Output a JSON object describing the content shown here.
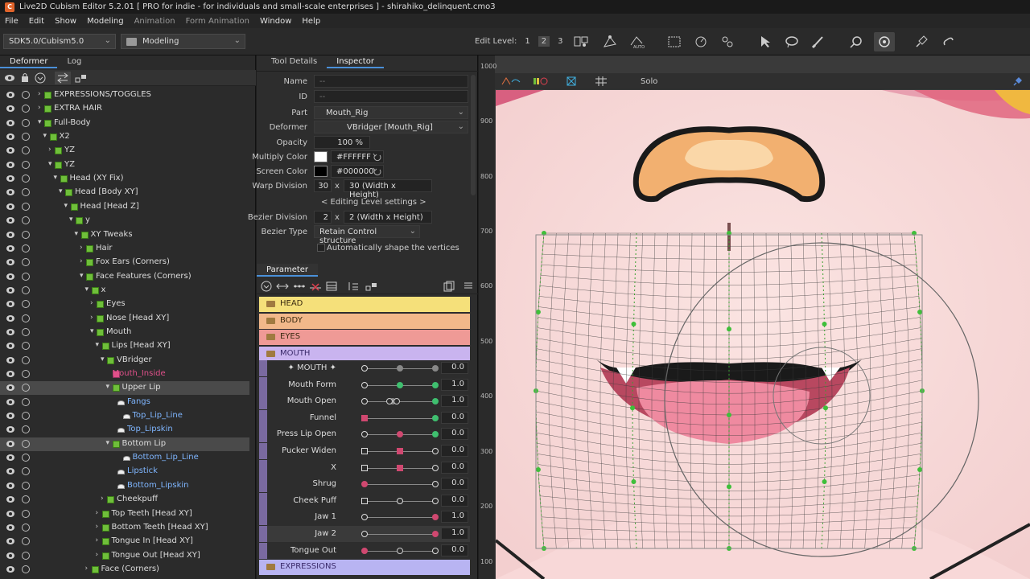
{
  "window": {
    "title": "Live2D Cubism Editor 5.2.01    [ PRO for indie - for individuals and small-scale enterprises ]  - shirahiko_delinquent.cmo3"
  },
  "menu": [
    "File",
    "Edit",
    "Show",
    "Modeling",
    "Animation",
    "Form Animation",
    "Window",
    "Help"
  ],
  "toolbar": {
    "sdk": "SDK5.0/Cubism5.0",
    "mode": "Modeling",
    "edit_level_label": "Edit Level:",
    "levels": [
      "1",
      "2",
      "3"
    ]
  },
  "left_tabs": [
    "Deformer",
    "Log"
  ],
  "tree": [
    {
      "label": "EXPRESSIONS/TOGGLES",
      "indent": 0,
      "type": "folder"
    },
    {
      "label": "EXTRA HAIR",
      "indent": 0,
      "type": "folder"
    },
    {
      "label": "Full-Body",
      "indent": 0,
      "type": "deformer",
      "open": true
    },
    {
      "label": "X2",
      "indent": 1,
      "type": "deformer",
      "open": true
    },
    {
      "label": "YZ",
      "indent": 2,
      "type": "deformer"
    },
    {
      "label": "YZ",
      "indent": 2,
      "type": "deformer",
      "open": true
    },
    {
      "label": "Head (XY Fix)",
      "indent": 3,
      "type": "deformer",
      "open": true
    },
    {
      "label": "Head [Body XY]",
      "indent": 4,
      "type": "deformer",
      "open": true
    },
    {
      "label": "Head [Head Z]",
      "indent": 5,
      "type": "deformer",
      "open": true
    },
    {
      "label": "y",
      "indent": 6,
      "type": "deformer",
      "open": true
    },
    {
      "label": "XY Tweaks",
      "indent": 7,
      "type": "deformer",
      "open": true
    },
    {
      "label": "Hair",
      "indent": 8,
      "type": "deformer"
    },
    {
      "label": "Fox Ears (Corners)",
      "indent": 8,
      "type": "deformer"
    },
    {
      "label": "Face Features (Corners)",
      "indent": 8,
      "type": "deformer",
      "open": true
    },
    {
      "label": "x",
      "indent": 9,
      "type": "deformer",
      "open": true
    },
    {
      "label": "Eyes",
      "indent": 10,
      "type": "deformer"
    },
    {
      "label": "Nose [Head XY]",
      "indent": 10,
      "type": "deformer"
    },
    {
      "label": "Mouth",
      "indent": 10,
      "type": "deformer",
      "open": true
    },
    {
      "label": "Lips [Head XY]",
      "indent": 11,
      "type": "deformer",
      "open": true
    },
    {
      "label": "VBridger",
      "indent": 12,
      "type": "deformer",
      "open": true
    },
    {
      "label": "Mouth_Inside",
      "indent": 13,
      "type": "clip"
    },
    {
      "label": "Upper Lip",
      "indent": 13,
      "type": "deformer",
      "open": true,
      "selected": true
    },
    {
      "label": "Fangs",
      "indent": 14,
      "type": "art"
    },
    {
      "label": "Top_Lip_Line",
      "indent": 15,
      "type": "art"
    },
    {
      "label": "Top_Lipskin",
      "indent": 14,
      "type": "art"
    },
    {
      "label": "Bottom Lip",
      "indent": 13,
      "type": "deformer",
      "open": true,
      "selected": true
    },
    {
      "label": "Bottom_Lip_Line",
      "indent": 15,
      "type": "art"
    },
    {
      "label": "Lipstick",
      "indent": 14,
      "type": "art"
    },
    {
      "label": "Bottom_Lipskin",
      "indent": 14,
      "type": "art"
    },
    {
      "label": "Cheekpuff",
      "indent": 12,
      "type": "deformer"
    },
    {
      "label": "Top Teeth [Head XY]",
      "indent": 11,
      "type": "deformer"
    },
    {
      "label": "Bottom Teeth [Head XY]",
      "indent": 11,
      "type": "deformer"
    },
    {
      "label": "Tongue In [Head XY]",
      "indent": 11,
      "type": "deformer"
    },
    {
      "label": "Tongue Out [Head XY]",
      "indent": 11,
      "type": "deformer"
    },
    {
      "label": "Face (Corners)",
      "indent": 9,
      "type": "deformer"
    }
  ],
  "inspector": {
    "tabs": [
      "Tool Details",
      "Inspector"
    ],
    "name_label": "Name",
    "name_value": "--",
    "id_label": "ID",
    "id_value": "--",
    "part_label": "Part",
    "part_value": "Mouth_Rig",
    "deformer_label": "Deformer",
    "deformer_value": "VBridger  [Mouth_Rig]",
    "opacity_label": "Opacity",
    "opacity_value": "100 %",
    "multiply_label": "Multiply Color",
    "multiply_value": "#FFFFFF",
    "multiply_color": "#ffffff",
    "screen_label": "Screen Color",
    "screen_value": "#000000",
    "screen_color": "#000000",
    "warp_label": "Warp Division",
    "warp_w": "30",
    "warp_x": "x",
    "warp_h": "30 (Width x Height)",
    "editing_level": "< Editing Level settings >",
    "bezier_div_label": "Bezier Division",
    "bezier_w": "2",
    "bezier_x": "x",
    "bezier_h": "2 (Width x Height)",
    "bezier_type_label": "Bezier Type",
    "bezier_type_value": "Retain Control structure",
    "auto_shape": "Automatically shape the vertices"
  },
  "parameter": {
    "tab": "Parameter",
    "groups": [
      {
        "name": "HEAD",
        "color": "#f5e07a"
      },
      {
        "name": "BODY",
        "color": "#f2b88a"
      },
      {
        "name": "EYES",
        "color": "#ef9a96"
      },
      {
        "name": "MOUTH",
        "color": "#c9b4ef"
      }
    ],
    "params": [
      {
        "name": "✦ MOUTH ✦",
        "value": "0.0",
        "knob": 0.5,
        "knob_color": "#888",
        "end_color": "#888"
      },
      {
        "name": "Mouth Form",
        "value": "1.0",
        "knob": 0.5,
        "knob_color": "#3fbf6f",
        "end_color": "#3fbf6f",
        "keys": [
          0,
          0.5,
          1
        ]
      },
      {
        "name": "Mouth Open",
        "value": "1.0",
        "knob": 0.4,
        "knob_color": "#888",
        "end_color": "#3fbf6f",
        "keys": [
          0,
          0.35,
          0.45,
          1
        ]
      },
      {
        "name": "Funnel",
        "value": "0.0",
        "knob": 0,
        "knob_color": "#d04870",
        "end_color": "#3fbf6f",
        "square": true
      },
      {
        "name": "Press Lip Open",
        "value": "0.0",
        "knob": 0.5,
        "knob_color": "#d04870",
        "end_color": "#3fbf6f",
        "keys": [
          0,
          1
        ]
      },
      {
        "name": "Pucker Widen",
        "value": "0.0",
        "knob": 0.5,
        "knob_color": "#d04870",
        "end_color": "#ddd",
        "square": true
      },
      {
        "name": "X",
        "value": "0.0",
        "knob": 0.5,
        "knob_color": "#d04870",
        "end_color": "#ddd",
        "square": true
      },
      {
        "name": "Shrug",
        "value": "0.0",
        "knob": 0,
        "knob_color": "#d04870",
        "end_color": "#ddd"
      },
      {
        "name": "Cheek Puff",
        "value": "0.0",
        "knob": 0.5,
        "knob_color": "#ddd",
        "end_color": "#ddd",
        "square": true,
        "start_color": "#d04870"
      },
      {
        "name": "Jaw 1",
        "value": "1.0",
        "knob": 1,
        "knob_color": "#d04870",
        "end_color": "#d04870"
      },
      {
        "name": "Jaw 2",
        "value": "1.0",
        "knob": 1,
        "knob_color": "#d04870",
        "end_color": "#d04870",
        "highlight": true
      },
      {
        "name": "Tongue Out",
        "value": "0.0",
        "knob": 0,
        "knob_color": "#d04870",
        "end_color": "#ddd",
        "mid": true
      }
    ],
    "footer_group": {
      "name": "EXPRESSIONS",
      "color": "#b8b4f2"
    }
  },
  "viewport": {
    "solo_label": "Solo",
    "ruler_ticks": [
      "1000",
      "900",
      "800",
      "700",
      "600",
      "500",
      "400",
      "300",
      "200",
      "100"
    ]
  }
}
